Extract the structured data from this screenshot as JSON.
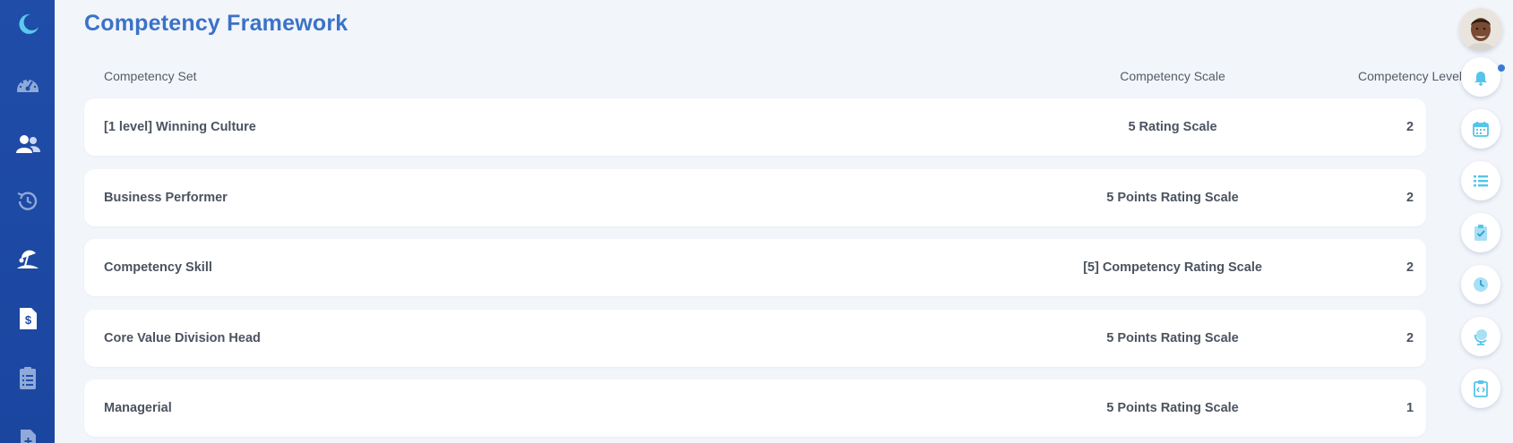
{
  "page": {
    "title": "Competency Framework"
  },
  "table": {
    "columns": {
      "set": "Competency Set",
      "scale": "Competency Scale",
      "level": "Competency Level"
    },
    "rows": [
      {
        "set": "[1 level] Winning Culture",
        "scale": "5 Rating Scale",
        "level": "2"
      },
      {
        "set": "Business Performer",
        "scale": "5 Points Rating Scale",
        "level": "2"
      },
      {
        "set": "Competency Skill",
        "scale": "[5] Competency Rating Scale",
        "level": "2"
      },
      {
        "set": "Core Value Division Head",
        "scale": "5 Points Rating Scale",
        "level": "2"
      },
      {
        "set": "Managerial",
        "scale": "5 Points Rating Scale",
        "level": "1"
      }
    ]
  },
  "sidebar": {
    "items": [
      {
        "icon": "moon-logo-icon"
      },
      {
        "icon": "dashboard-gauge-icon"
      },
      {
        "icon": "people-icon"
      },
      {
        "icon": "history-clock-icon"
      },
      {
        "icon": "beach-umbrella-icon"
      },
      {
        "icon": "payroll-document-icon"
      },
      {
        "icon": "clipboard-list-icon"
      },
      {
        "icon": "add-document-icon"
      }
    ]
  },
  "rail": {
    "items": [
      {
        "icon": "bell-icon"
      },
      {
        "icon": "calendar-icon"
      },
      {
        "icon": "list-icon"
      },
      {
        "icon": "clipboard-check-icon"
      },
      {
        "icon": "clock-icon"
      },
      {
        "icon": "globe-icon"
      },
      {
        "icon": "code-clipboard-icon"
      }
    ]
  },
  "colors": {
    "sidebar": "#1f4da8",
    "title": "#3b72c8",
    "accent_light": "#55c4ea",
    "background": "#f2f5fa"
  }
}
